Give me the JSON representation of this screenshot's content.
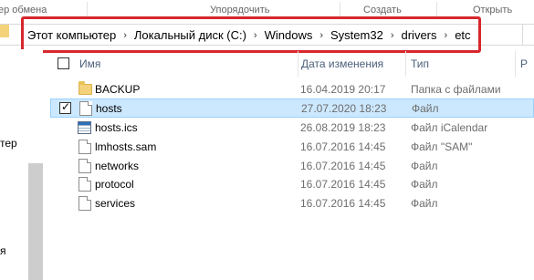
{
  "ribbon": {
    "clipboard_label": "ер обмена",
    "organize_label": "Упорядочить",
    "new_label": "Создать",
    "open_label": "Открыть"
  },
  "address_bar": {
    "crumbs": [
      "Этот компьютер",
      "Локальный диск (C:)",
      "Windows",
      "System32",
      "drivers",
      "etc"
    ],
    "separator": "›",
    "highlight_color": "#d7262c"
  },
  "nav_pane": {
    "items": [
      "тер",
      "я"
    ]
  },
  "columns": {
    "name": "Имя",
    "date": "Дата изменения",
    "type": "Тип",
    "size": "Р"
  },
  "files": [
    {
      "name": "BACKUP",
      "date": "16.04.2019 20:17",
      "type": "Папка с файлами",
      "icon": "folder-icon",
      "selected": false
    },
    {
      "name": "hosts",
      "date": "27.07.2020 18:23",
      "type": "Файл",
      "icon": "file-icon",
      "selected": true
    },
    {
      "name": "hosts.ics",
      "date": "26.08.2019 18:23",
      "type": "Файл iCalendar",
      "icon": "calendar-file-icon",
      "selected": false
    },
    {
      "name": "lmhosts.sam",
      "date": "16.07.2016 14:45",
      "type": "Файл \"SAM\"",
      "icon": "file-icon",
      "selected": false
    },
    {
      "name": "networks",
      "date": "16.07.2016 14:45",
      "type": "Файл",
      "icon": "file-icon",
      "selected": false
    },
    {
      "name": "protocol",
      "date": "16.07.2016 14:45",
      "type": "Файл",
      "icon": "file-icon",
      "selected": false
    },
    {
      "name": "services",
      "date": "16.07.2016 14:45",
      "type": "Файл",
      "icon": "file-icon",
      "selected": false
    }
  ],
  "colors": {
    "selection_bg": "#cce8ff",
    "selection_border": "#99d1ff",
    "header_text": "#4c607a"
  }
}
